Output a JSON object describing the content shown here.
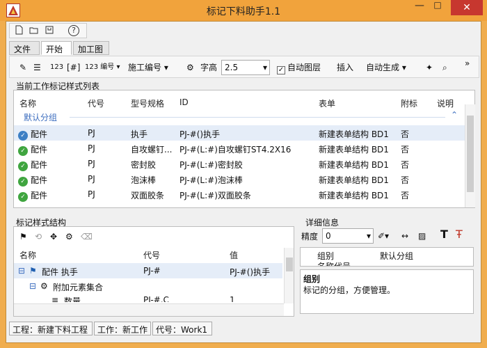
{
  "window": {
    "title": "标记下料助手1.1",
    "minimize": "—",
    "maximize": "□",
    "close": "✕"
  },
  "quick_toolbar": {
    "new_icon": "new-icon",
    "open_icon": "open-icon",
    "save_icon": "save-icon",
    "help_icon": "help-icon",
    "help_glyph": "?"
  },
  "tabs": [
    "文件",
    "开始",
    "加工图"
  ],
  "toolbar": {
    "number_label": "编号",
    "process_number_label": "施工编号",
    "font_height_label": "字高",
    "font_height_value": "2.5",
    "auto_layer_label": "自动图层",
    "insert_label": "插入",
    "auto_generate_label": "自动生成",
    "more": "»"
  },
  "list": {
    "title": "当前工作标记样式列表",
    "columns": [
      "名称",
      "代号",
      "型号规格",
      "ID",
      "表单",
      "附标",
      "说明"
    ],
    "group_label": "默认分组",
    "rows": [
      {
        "name": "配件",
        "code": "PJ",
        "spec": "执手",
        "id": "PJ-#()执手",
        "form": "新建表单结构 BD1",
        "attach": "否"
      },
      {
        "name": "配件",
        "code": "PJ",
        "spec": "自攻螺钉...",
        "id": "PJ-#(L:#)自攻螺钉ST4.2X16",
        "form": "新建表单结构 BD1",
        "attach": "否"
      },
      {
        "name": "配件",
        "code": "PJ",
        "spec": "密封胶",
        "id": "PJ-#(L:#)密封胶",
        "form": "新建表单结构 BD1",
        "attach": "否"
      },
      {
        "name": "配件",
        "code": "PJ",
        "spec": "泡沫棒",
        "id": "PJ-#(L:#)泡沫棒",
        "form": "新建表单结构 BD1",
        "attach": "否"
      },
      {
        "name": "配件",
        "code": "PJ",
        "spec": "双面胶条",
        "id": "PJ-#(L:#)双面胶条",
        "form": "新建表单结构 BD1",
        "attach": "否"
      }
    ]
  },
  "structure": {
    "title": "标记样式结构",
    "columns": [
      "名称",
      "代号",
      "值"
    ],
    "rows": [
      {
        "name": "配件 执手",
        "code": "PJ-#",
        "value": "PJ-#()执手"
      },
      {
        "name": "附加元素集合",
        "code": "",
        "value": ""
      },
      {
        "name": "数量",
        "code": "PJ-#.C",
        "value": "1"
      }
    ]
  },
  "details": {
    "title": "详细信息",
    "precision_label": "精度",
    "precision_value": "0",
    "prop_name": "组别",
    "prop_value": "默认分组",
    "prop_next": "名称代号",
    "desc_title": "组别",
    "desc_text": "标记的分组，方便管理。"
  },
  "statusbar": [
    "工程：新建下料工程",
    "工作：新工作",
    "代号：Work1"
  ],
  "colors": {
    "titlebar": "#f1a33c",
    "close": "#c7372f",
    "ok": "#3fa53f",
    "selected": "#e5edf8"
  }
}
